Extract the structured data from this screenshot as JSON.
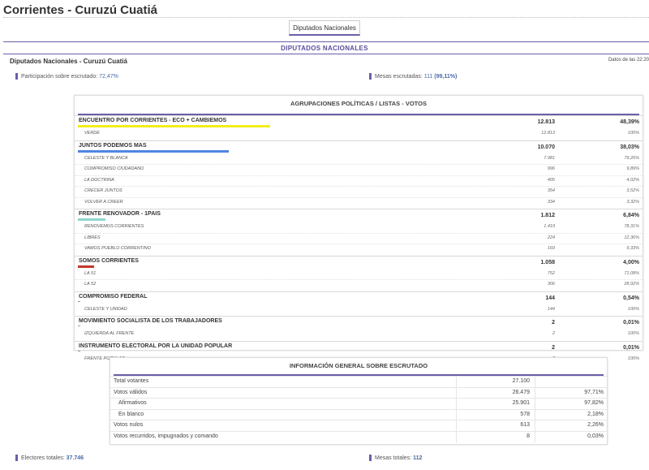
{
  "page": {
    "title": "Corrientes - Curuzú Cuatiá"
  },
  "tabs": [
    {
      "label": "Diputados Nacionales"
    }
  ],
  "section": {
    "title": "DIPUTADOS NACIONALES",
    "subheading": "Diputados Nacionales - Curuzú Cuatiá",
    "datos_label": "Datos de las 22:20"
  },
  "stats_top": {
    "participacion_label": "Participación sobre escrutado:",
    "participacion_value": "72,47%",
    "mesas_label": "Mesas escrutadas:",
    "mesas_value": "111",
    "mesas_pct": "(99,11%)"
  },
  "results": {
    "header": "AGRUPACIONES POLÍTICAS / LISTAS - VOTOS",
    "parties": [
      {
        "name": "ENCUENTRO POR CORRIENTES - ECO + CAMBIEMOS",
        "votes": "12.813",
        "pct": "48,39%",
        "color": "#f0ef1a",
        "share": 0.4839,
        "lists": [
          {
            "name": "VERDE",
            "votes": "12.813",
            "pct": "100%"
          }
        ]
      },
      {
        "name": "JUNTOS PODEMOS MAS",
        "votes": "10.070",
        "pct": "38,03%",
        "color": "#4f86e0",
        "share": 0.3803,
        "lists": [
          {
            "name": "CELESTE Y BLANCA",
            "votes": "7.981",
            "pct": "79,26%"
          },
          {
            "name": "COMPROMISO CIUDADANO",
            "votes": "996",
            "pct": "9,89%"
          },
          {
            "name": "LA DOCTRINA",
            "votes": "405",
            "pct": "4,02%"
          },
          {
            "name": "CRECER JUNTOS",
            "votes": "354",
            "pct": "3,52%"
          },
          {
            "name": "VOLVER A CREER",
            "votes": "334",
            "pct": "3,32%"
          }
        ]
      },
      {
        "name": "FRENTE RENOVADOR - 1PAIS",
        "votes": "1.812",
        "pct": "6,84%",
        "color": "#8fd6cf",
        "share": 0.0684,
        "lists": [
          {
            "name": "RENOVEMOS CORRIENTES",
            "votes": "1.419",
            "pct": "78,31%"
          },
          {
            "name": "LIBRES",
            "votes": "224",
            "pct": "12,36%"
          },
          {
            "name": "VAMOS PUEBLO CORRENTINO",
            "votes": "169",
            "pct": "9,33%"
          }
        ]
      },
      {
        "name": "SOMOS CORRIENTES",
        "votes": "1.058",
        "pct": "4,00%",
        "color": "#c0392b",
        "share": 0.04,
        "lists": [
          {
            "name": "LA 51",
            "votes": "752",
            "pct": "71,08%"
          },
          {
            "name": "LA 52",
            "votes": "306",
            "pct": "28,92%"
          }
        ]
      },
      {
        "name": "COMPROMISO FEDERAL",
        "votes": "144",
        "pct": "0,54%",
        "color": "#999999",
        "share": 0.0054,
        "lists": [
          {
            "name": "CELESTE Y UNIDAD",
            "votes": "144",
            "pct": "100%"
          }
        ]
      },
      {
        "name": "MOVIMIENTO SOCIALISTA DE LOS TRABAJADORES",
        "votes": "2",
        "pct": "0,01%",
        "color": "#999999",
        "share": 0.0001,
        "lists": [
          {
            "name": "IZQUIERDA AL FRENTE",
            "votes": "2",
            "pct": "100%"
          }
        ]
      },
      {
        "name": "INSTRUMENTO ELECTORAL POR LA UNIDAD POPULAR",
        "votes": "2",
        "pct": "0,01%",
        "color": "#999999",
        "share": 0.0001,
        "lists": [
          {
            "name": "FRENTE POPULAR",
            "votes": "2",
            "pct": "100%"
          }
        ]
      }
    ]
  },
  "info": {
    "header": "INFORMACIÓN GENERAL SOBRE ESCRUTADO",
    "rows": [
      {
        "label": "Total votantes",
        "value": "27.100",
        "pct": "",
        "indent": false
      },
      {
        "label": "Votos válidos",
        "value": "26.479",
        "pct": "97,71%",
        "indent": false
      },
      {
        "label": "Afirmativos",
        "value": "25.901",
        "pct": "97,82%",
        "indent": true
      },
      {
        "label": "En blanco",
        "value": "578",
        "pct": "2,18%",
        "indent": true
      },
      {
        "label": "Votos nulos",
        "value": "613",
        "pct": "2,26%",
        "indent": false
      },
      {
        "label": "Votos recurridos, impugnados y comando",
        "value": "8",
        "pct": "0,03%",
        "indent": false
      }
    ]
  },
  "stats_bottom": {
    "electores_label": "Electores totales:",
    "electores_value": "37.746",
    "mesas_label": "Mesas totales:",
    "mesas_value": "112"
  }
}
